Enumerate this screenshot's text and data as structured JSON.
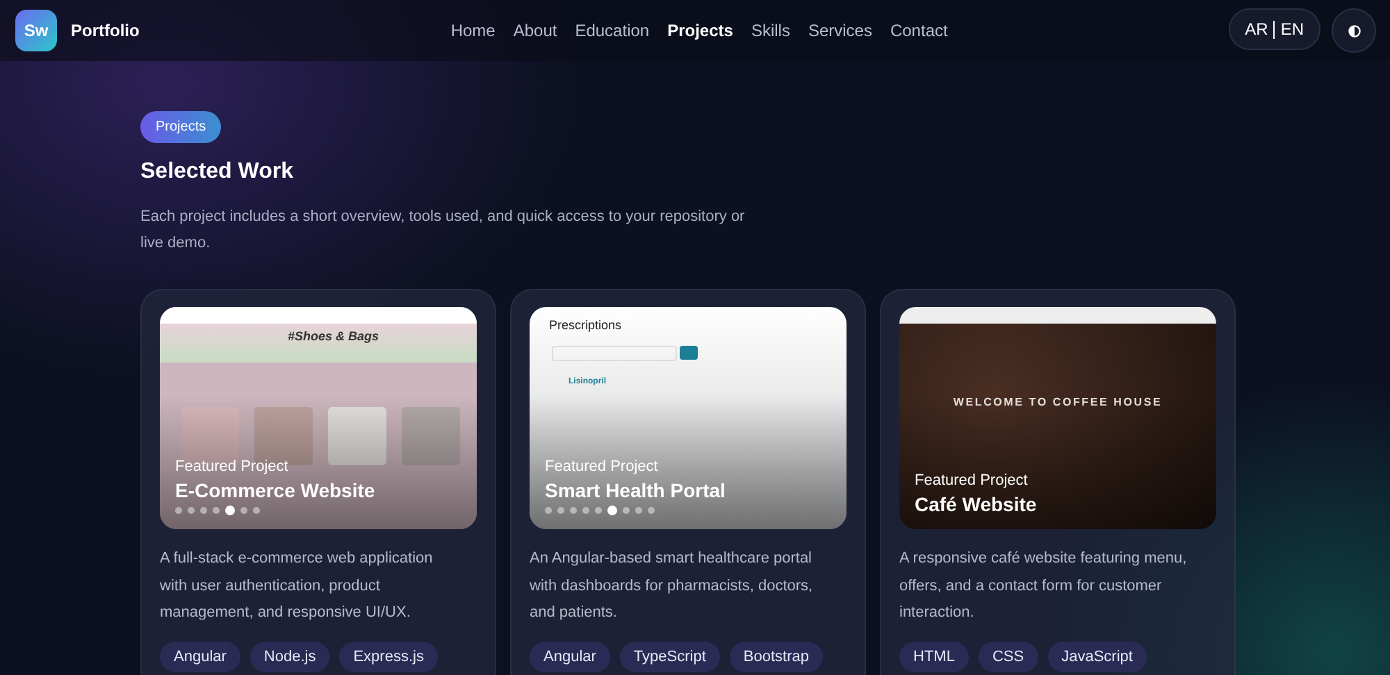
{
  "brand": {
    "logo": "Sw",
    "name": "Portfolio"
  },
  "nav": [
    {
      "label": "Home",
      "selected": false
    },
    {
      "label": "About",
      "selected": false
    },
    {
      "label": "Education",
      "selected": false
    },
    {
      "label": "Projects",
      "selected": true
    },
    {
      "label": "Skills",
      "selected": false
    },
    {
      "label": "Services",
      "selected": false
    },
    {
      "label": "Contact",
      "selected": false
    }
  ],
  "language": {
    "options": [
      "AR",
      "EN"
    ]
  },
  "section": {
    "badge": "Projects",
    "title": "Selected Work",
    "intro": "Each project includes a short overview, tools used, and quick access to your repository or live demo."
  },
  "projects": [
    {
      "preview": {
        "kind": "shop",
        "heading": "#Shoes & Bags"
      },
      "eyebrow": "Featured Project",
      "title": "E-Commerce Website",
      "dots": [
        {
          "selected": false
        },
        {
          "selected": false
        },
        {
          "selected": false
        },
        {
          "selected": false
        },
        {
          "selected": true
        },
        {
          "selected": false
        },
        {
          "selected": false
        }
      ],
      "description": "A full-stack e-commerce web application with user authentication, product management, and responsive UI/UX.",
      "tags": [
        "Angular",
        "Node.js",
        "Express.js"
      ]
    },
    {
      "preview": {
        "kind": "dashboard",
        "heading": "Prescriptions",
        "item": "Lisinopril"
      },
      "eyebrow": "Featured Project",
      "title": "Smart Health Portal",
      "dots": [
        {
          "selected": false
        },
        {
          "selected": false
        },
        {
          "selected": false
        },
        {
          "selected": false
        },
        {
          "selected": false
        },
        {
          "selected": true
        },
        {
          "selected": false
        },
        {
          "selected": false
        },
        {
          "selected": false
        }
      ],
      "description": "An Angular-based smart healthcare portal with dashboards for pharmacists, doctors, and patients.",
      "tags": [
        "Angular",
        "TypeScript",
        "Bootstrap"
      ]
    },
    {
      "preview": {
        "kind": "cafe",
        "heading": "WELCOME TO COFFEE HOUSE"
      },
      "eyebrow": "Featured Project",
      "title": "Café Website",
      "description": "A responsive café website featuring menu, offers, and a contact form for customer interaction.",
      "tags": [
        "HTML",
        "CSS",
        "JavaScript"
      ]
    }
  ]
}
